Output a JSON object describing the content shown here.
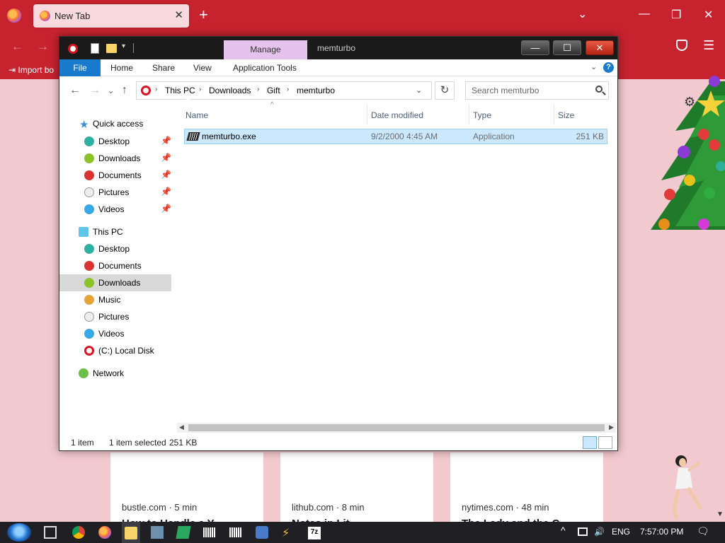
{
  "browser": {
    "tab_title": "New Tab",
    "tab_close": "✕",
    "new_tab": "+",
    "list_all_tabs": "⌄",
    "win_min": "—",
    "win_max": "❐",
    "win_close": "✕",
    "back": "←",
    "forward": "→",
    "import_bookmarks": "Import bo",
    "menu": "☰",
    "settings": "⚙",
    "cards": [
      {
        "source": "bustle.com · 5 min",
        "title": "How to Handle a Y"
      },
      {
        "source": "lithub.com · 8 min",
        "title": "Notes in Lit"
      },
      {
        "source": "nytimes.com · 48 min",
        "title": "The Lady and the C"
      }
    ],
    "scroll_down": "▼"
  },
  "explorer": {
    "title": "memturbo",
    "context_tab": "Manage",
    "qat_dropdown": "▾",
    "min_label": "—",
    "max_label": "☐",
    "close_label": "✕",
    "ribbon_tabs": [
      "File",
      "Home",
      "Share",
      "View",
      "Application Tools"
    ],
    "ribbon_chevron": "⌄",
    "help": "?",
    "nav_back": "←",
    "nav_forward": "→",
    "nav_recent": "⌄",
    "nav_up": "↑",
    "breadcrumbs": [
      "This PC",
      "Downloads",
      "Gift",
      "memturbo"
    ],
    "crumb_sep": "›",
    "address_dropdown": "⌄",
    "refresh": "↻",
    "search_placeholder": "Search memturbo",
    "nav_pane": {
      "quick_access": {
        "label": "Quick access",
        "items": [
          "Desktop",
          "Downloads",
          "Documents",
          "Pictures",
          "Videos"
        ]
      },
      "pin": "📌",
      "this_pc": {
        "label": "This PC",
        "items": [
          "Desktop",
          "Documents",
          "Downloads",
          "Music",
          "Pictures",
          "Videos",
          "(C:) Local Disk"
        ]
      },
      "network": "Network"
    },
    "columns": [
      "Name",
      "Date modified",
      "Type",
      "Size"
    ],
    "sort_arrow": "^",
    "files": [
      {
        "name": "memturbo.exe",
        "date": "9/2/2000 4:45 AM",
        "type": "Application",
        "size": "251 KB"
      }
    ],
    "scroll_left": "◀",
    "scroll_right": "▶",
    "status": {
      "count": "1 item",
      "selected": "1 item selected",
      "size": "251 KB"
    }
  },
  "taskbar": {
    "tray_chevron": "^",
    "language": "ENG",
    "time": "7:57:00 PM",
    "notifications": "🗨"
  },
  "colors": {
    "firefox_red": "#c7232f",
    "explorer_blue": "#1979ca",
    "selection": "#cce8ff",
    "manage_tab": "#e6c3ec"
  }
}
